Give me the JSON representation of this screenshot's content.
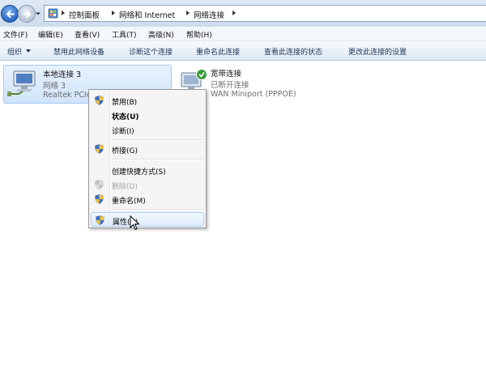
{
  "address": {
    "breadcrumbs": [
      "控制面板",
      "网络和 Internet",
      "网络连接"
    ],
    "icon": "control-panel-icon"
  },
  "menu": {
    "items": [
      "文件(F)",
      "编辑(E)",
      "查看(V)",
      "工具(T)",
      "高级(N)",
      "帮助(H)"
    ]
  },
  "commands": {
    "organize": "组织",
    "items": [
      "禁用此网络设备",
      "诊断这个连接",
      "重命名此连接",
      "查看此连接的状态",
      "更改此连接的设置"
    ]
  },
  "connections": [
    {
      "name": "本地连接 3",
      "status": "网络  3",
      "device": "Realtek PCIe",
      "icon": "network-adapter-icon",
      "selected": true
    },
    {
      "name": "宽带连接",
      "status": "已断开连接",
      "device": "WAN Miniport (PPPOE)",
      "icon": "broadband-connection-icon",
      "selected": false
    }
  ],
  "context_menu": {
    "items": [
      {
        "label": "禁用(B)",
        "icon": "shield-icon"
      },
      {
        "label": "状态(U)",
        "bold": true
      },
      {
        "label": "诊断(I)"
      },
      {
        "label": "桥接(G)",
        "icon": "shield-icon"
      },
      {
        "label": "创建快捷方式(S)"
      },
      {
        "label": "删除(D)",
        "icon": "shield-icon",
        "disabled": true
      },
      {
        "label": "重命名(M)",
        "icon": "shield-icon"
      },
      {
        "label": "属性(R)",
        "icon": "shield-icon",
        "hovered": true
      }
    ]
  },
  "colors": {
    "accent": "#2a66c4",
    "selection": "#d0e4fb",
    "command_text": "#1e395b"
  }
}
